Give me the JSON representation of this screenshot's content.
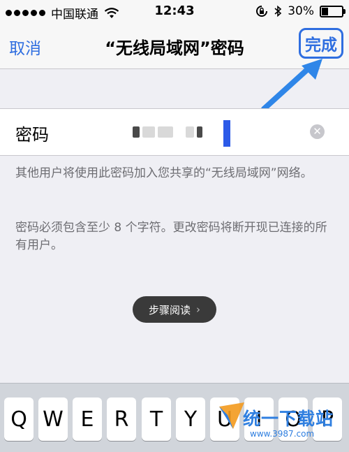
{
  "status_bar": {
    "carrier": "中国联通",
    "time": "12:43",
    "battery_percent": "30%",
    "battery_level": 0.3
  },
  "nav": {
    "cancel_label": "取消",
    "title": "“无线局域网”密码",
    "done_label": "完成"
  },
  "field": {
    "label": "密码"
  },
  "notes": {
    "line1": "其他用户将使用此密码加入您共享的“无线局域网”网络。",
    "line2": "密码必须包含至少 8 个字符。更改密码将断开现已连接的所有用户。"
  },
  "toast": {
    "label": "步骤阅读"
  },
  "keyboard": {
    "keys": [
      "Q",
      "W",
      "E",
      "R",
      "T",
      "Y",
      "U",
      "I",
      "O",
      "P"
    ]
  },
  "watermark": {
    "text": "统一下载站",
    "url": "www.3987.com"
  },
  "colors": {
    "accent": "#2f6ee0",
    "cursor": "#2c5ae8"
  }
}
